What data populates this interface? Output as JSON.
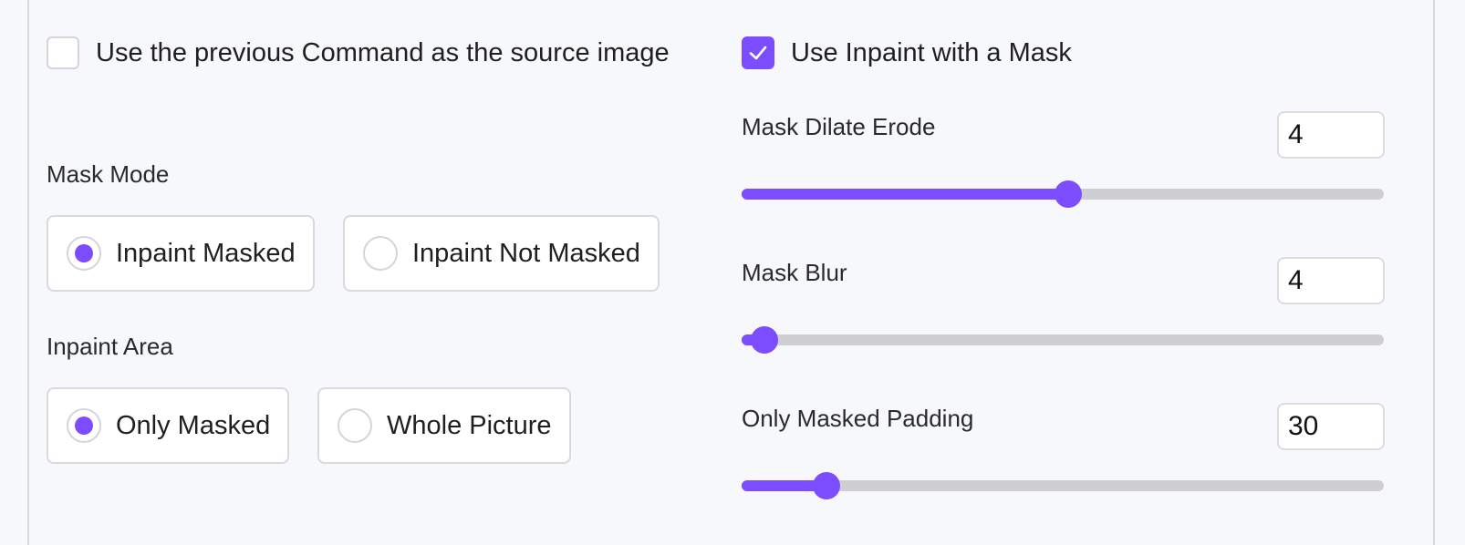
{
  "left": {
    "use_previous_command": {
      "label": "Use the previous Command as the source image",
      "checked": false
    },
    "mask_mode": {
      "label": "Mask Mode",
      "options": [
        {
          "label": "Inpaint Masked",
          "selected": true
        },
        {
          "label": "Inpaint Not Masked",
          "selected": false
        }
      ]
    },
    "inpaint_area": {
      "label": "Inpaint Area",
      "options": [
        {
          "label": "Only Masked",
          "selected": true
        },
        {
          "label": "Whole Picture",
          "selected": false
        }
      ]
    }
  },
  "right": {
    "use_inpaint_mask": {
      "label": "Use Inpaint with a Mask",
      "checked": true
    },
    "sliders": [
      {
        "label": "Mask Dilate Erode",
        "value": "4",
        "fraction": 0.508
      },
      {
        "label": "Mask Blur",
        "value": "4",
        "fraction": 0.035
      },
      {
        "label": "Only Masked Padding",
        "value": "30",
        "fraction": 0.132
      }
    ]
  },
  "colors": {
    "accent": "#7c4dff",
    "track": "#cfcfd2",
    "background": "#f7f8fc"
  },
  "icons": {
    "checkmark": "check-icon"
  }
}
